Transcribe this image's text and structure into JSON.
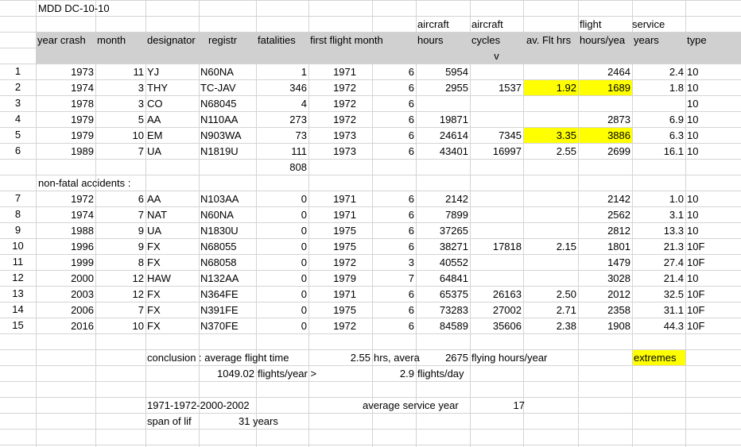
{
  "title": "MDD DC-10-10",
  "header_top": {
    "aircraft1": "aircraft",
    "aircraft2": "aircraft",
    "flight": "flight",
    "service": "service"
  },
  "headers": {
    "year_crash": "year crash",
    "month": "month",
    "designator": "designator",
    "registr": "registr",
    "fatalities": "fatalities",
    "first_flight_month": "first flight month",
    "hours": "hours",
    "cycles": "cycles",
    "av_flt_hrs": "av. Flt hrs",
    "hours_year": "hours/yea",
    "years": "years",
    "type": "type"
  },
  "filter_glyph": "v",
  "fatal_rows": [
    {
      "n": "1",
      "year": "1973",
      "month": "11",
      "des": "YJ",
      "reg": "N60NA",
      "fat": "1",
      "ff": "1971",
      "ffm": "6",
      "hours": "5954",
      "cycles": "",
      "avflt": "",
      "hy": "2464",
      "svc": "2.4",
      "type": "10"
    },
    {
      "n": "2",
      "year": "1974",
      "month": "3",
      "des": "THY",
      "reg": "TC-JAV",
      "fat": "346",
      "ff": "1972",
      "ffm": "6",
      "hours": "2955",
      "cycles": "1537",
      "avflt": "1.92",
      "hy": "1689",
      "svc": "1.8",
      "type": "10"
    },
    {
      "n": "3",
      "year": "1978",
      "month": "3",
      "des": "CO",
      "reg": "N68045",
      "fat": "4",
      "ff": "1972",
      "ffm": "6",
      "hours": "",
      "cycles": "",
      "avflt": "",
      "hy": "",
      "svc": "",
      "type": "10"
    },
    {
      "n": "4",
      "year": "1979",
      "month": "5",
      "des": "AA",
      "reg": "N110AA",
      "fat": "273",
      "ff": "1972",
      "ffm": "6",
      "hours": "19871",
      "cycles": "",
      "avflt": "",
      "hy": "2873",
      "svc": "6.9",
      "type": "10"
    },
    {
      "n": "5",
      "year": "1979",
      "month": "10",
      "des": "EM",
      "reg": "N903WA",
      "fat": "73",
      "ff": "1973",
      "ffm": "6",
      "hours": "24614",
      "cycles": "7345",
      "avflt": "3.35",
      "hy": "3886",
      "svc": "6.3",
      "type": "10"
    },
    {
      "n": "6",
      "year": "1989",
      "month": "7",
      "des": "UA",
      "reg": "N1819U",
      "fat": "111",
      "ff": "1973",
      "ffm": "6",
      "hours": "43401",
      "cycles": "16997",
      "avflt": "2.55",
      "hy": "2699",
      "svc": "16.1",
      "type": "10"
    }
  ],
  "fatal_total": "808",
  "nonfatal_label": "non-fatal accidents :",
  "nonfatal_rows": [
    {
      "n": "7",
      "year": "1972",
      "month": "6",
      "des": "AA",
      "reg": "N103AA",
      "fat": "0",
      "ff": "1971",
      "ffm": "6",
      "hours": "2142",
      "cycles": "",
      "avflt": "",
      "hy": "2142",
      "svc": "1.0",
      "type": "10"
    },
    {
      "n": "8",
      "year": "1974",
      "month": "7",
      "des": "NAT",
      "reg": "N60NA",
      "fat": "0",
      "ff": "1971",
      "ffm": "6",
      "hours": "7899",
      "cycles": "",
      "avflt": "",
      "hy": "2562",
      "svc": "3.1",
      "type": "10"
    },
    {
      "n": "9",
      "year": "1988",
      "month": "9",
      "des": "UA",
      "reg": "N1830U",
      "fat": "0",
      "ff": "1975",
      "ffm": "6",
      "hours": "37265",
      "cycles": "",
      "avflt": "",
      "hy": "2812",
      "svc": "13.3",
      "type": "10"
    },
    {
      "n": "10",
      "year": "1996",
      "month": "9",
      "des": "FX",
      "reg": "N68055",
      "fat": "0",
      "ff": "1975",
      "ffm": "6",
      "hours": "38271",
      "cycles": "17818",
      "avflt": "2.15",
      "hy": "1801",
      "svc": "21.3",
      "type": "10F"
    },
    {
      "n": "11",
      "year": "1999",
      "month": "8",
      "des": "FX",
      "reg": "N68058",
      "fat": "0",
      "ff": "1972",
      "ffm": "3",
      "hours": "40552",
      "cycles": "",
      "avflt": "",
      "hy": "1479",
      "svc": "27.4",
      "type": "10F"
    },
    {
      "n": "12",
      "year": "2000",
      "month": "12",
      "des": "HAW",
      "reg": "N132AA",
      "fat": "0",
      "ff": "1979",
      "ffm": "7",
      "hours": "64841",
      "cycles": "",
      "avflt": "",
      "hy": "3028",
      "svc": "21.4",
      "type": "10"
    },
    {
      "n": "13",
      "year": "2003",
      "month": "12",
      "des": "FX",
      "reg": "N364FE",
      "fat": "0",
      "ff": "1971",
      "ffm": "6",
      "hours": "65375",
      "cycles": "26163",
      "avflt": "2.50",
      "hy": "2012",
      "svc": "32.5",
      "type": "10F"
    },
    {
      "n": "14",
      "year": "2006",
      "month": "7",
      "des": "FX",
      "reg": "N391FE",
      "fat": "0",
      "ff": "1975",
      "ffm": "6",
      "hours": "73283",
      "cycles": "27002",
      "avflt": "2.71",
      "hy": "2358",
      "svc": "31.1",
      "type": "10F"
    },
    {
      "n": "15",
      "year": "2016",
      "month": "10",
      "des": "FX",
      "reg": "N370FE",
      "fat": "0",
      "ff": "1972",
      "ffm": "6",
      "hours": "84589",
      "cycles": "35606",
      "avflt": "2.38",
      "hy": "1908",
      "svc": "44.3",
      "type": "10F"
    }
  ],
  "conclusion": {
    "label": "conclusion : average flight time",
    "avg_flt_value": "2.55",
    "hrs_label": "hrs, avera",
    "flying_hours_value": "2675",
    "flying_hours_label": "flying hours/year",
    "extremes": "extremes",
    "flights_year_value": "1049.02",
    "flights_year_label": "flights/year >",
    "flights_day_value": "2.9",
    "flights_day_label": "flights/day"
  },
  "span": {
    "years_range": "1971-1972-2000-2002",
    "avg_service_label": "average service year",
    "avg_service_value": "17",
    "span_label": "span of lif",
    "span_value": "31 years"
  },
  "colors": {
    "highlight": "#ffff00",
    "header_gray": "#d0d0d0",
    "gridline": "#d4d4d4"
  }
}
